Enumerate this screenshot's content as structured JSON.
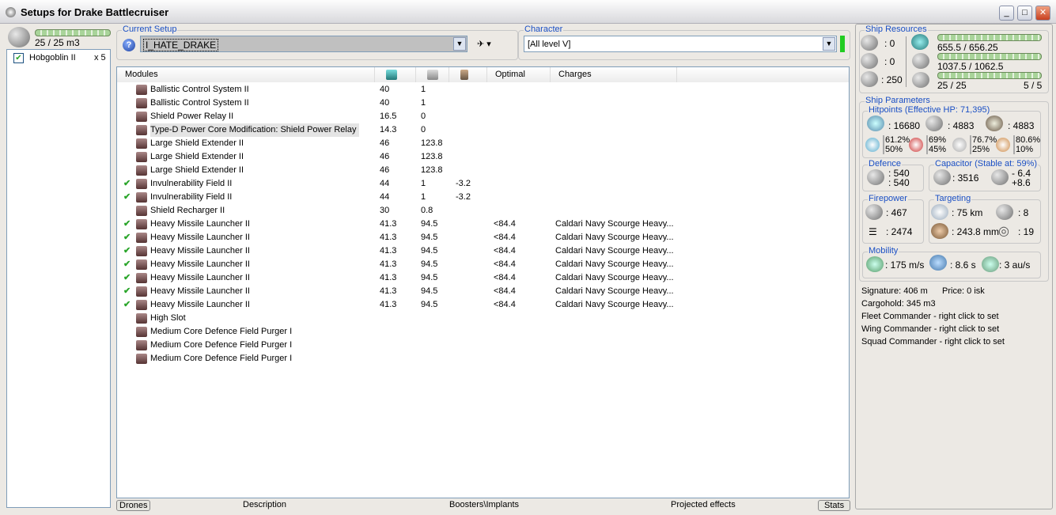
{
  "window": {
    "title": "Setups for Drake Battlecruiser"
  },
  "drones": {
    "bay": "25 / 25 m3",
    "items": [
      {
        "name": "Hobgoblin II",
        "count": "x 5",
        "checked": true
      }
    ]
  },
  "current_setup": {
    "label": "Current Setup",
    "value": "I_HATE_DRAKE"
  },
  "character": {
    "label": "Character",
    "value": "[All level V]",
    "status_color": "#22cc22"
  },
  "modules": {
    "headers": [
      "Modules",
      "cpu-icon",
      "powergrid-icon",
      "capacitor-icon",
      "Optimal",
      "Charges"
    ],
    "rows": [
      {
        "state": "",
        "name": "Ballistic Control System II",
        "cpu": "40",
        "pg": "1",
        "cap": "",
        "optimal": "",
        "charges": ""
      },
      {
        "state": "",
        "name": "Ballistic Control System II",
        "cpu": "40",
        "pg": "1",
        "cap": "",
        "optimal": "",
        "charges": ""
      },
      {
        "state": "",
        "name": "Shield Power Relay II",
        "cpu": "16.5",
        "pg": "0",
        "cap": "",
        "optimal": "",
        "charges": ""
      },
      {
        "state": "",
        "name": "Type-D Power Core Modification: Shield Power Relay",
        "cpu": "14.3",
        "pg": "0",
        "cap": "",
        "optimal": "",
        "charges": "",
        "selected": true
      },
      {
        "state": "",
        "name": "Large Shield Extender II",
        "cpu": "46",
        "pg": "123.8",
        "cap": "",
        "optimal": "",
        "charges": ""
      },
      {
        "state": "",
        "name": "Large Shield Extender II",
        "cpu": "46",
        "pg": "123.8",
        "cap": "",
        "optimal": "",
        "charges": ""
      },
      {
        "state": "",
        "name": "Large Shield Extender II",
        "cpu": "46",
        "pg": "123.8",
        "cap": "",
        "optimal": "",
        "charges": ""
      },
      {
        "state": "✔",
        "name": "Invulnerability Field II",
        "cpu": "44",
        "pg": "1",
        "cap": "-3.2",
        "optimal": "",
        "charges": ""
      },
      {
        "state": "✔",
        "name": "Invulnerability Field II",
        "cpu": "44",
        "pg": "1",
        "cap": "-3.2",
        "optimal": "",
        "charges": ""
      },
      {
        "state": "",
        "name": "Shield Recharger II",
        "cpu": "30",
        "pg": "0.8",
        "cap": "",
        "optimal": "",
        "charges": ""
      },
      {
        "state": "✔",
        "name": "Heavy Missile Launcher II",
        "cpu": "41.3",
        "pg": "94.5",
        "cap": "",
        "optimal": "<84.4",
        "charges": "Caldari Navy Scourge Heavy..."
      },
      {
        "state": "✔",
        "name": "Heavy Missile Launcher II",
        "cpu": "41.3",
        "pg": "94.5",
        "cap": "",
        "optimal": "<84.4",
        "charges": "Caldari Navy Scourge Heavy..."
      },
      {
        "state": "✔",
        "name": "Heavy Missile Launcher II",
        "cpu": "41.3",
        "pg": "94.5",
        "cap": "",
        "optimal": "<84.4",
        "charges": "Caldari Navy Scourge Heavy..."
      },
      {
        "state": "✔",
        "name": "Heavy Missile Launcher II",
        "cpu": "41.3",
        "pg": "94.5",
        "cap": "",
        "optimal": "<84.4",
        "charges": "Caldari Navy Scourge Heavy..."
      },
      {
        "state": "✔",
        "name": "Heavy Missile Launcher II",
        "cpu": "41.3",
        "pg": "94.5",
        "cap": "",
        "optimal": "<84.4",
        "charges": "Caldari Navy Scourge Heavy..."
      },
      {
        "state": "✔",
        "name": "Heavy Missile Launcher II",
        "cpu": "41.3",
        "pg": "94.5",
        "cap": "",
        "optimal": "<84.4",
        "charges": "Caldari Navy Scourge Heavy..."
      },
      {
        "state": "✔",
        "name": "Heavy Missile Launcher II",
        "cpu": "41.3",
        "pg": "94.5",
        "cap": "",
        "optimal": "<84.4",
        "charges": "Caldari Navy Scourge Heavy..."
      },
      {
        "state": "",
        "name": "High Slot",
        "cpu": "",
        "pg": "",
        "cap": "",
        "optimal": "",
        "charges": ""
      },
      {
        "state": "",
        "name": "Medium Core Defence Field Purger I",
        "cpu": "",
        "pg": "",
        "cap": "",
        "optimal": "",
        "charges": ""
      },
      {
        "state": "",
        "name": "Medium Core Defence Field Purger I",
        "cpu": "",
        "pg": "",
        "cap": "",
        "optimal": "",
        "charges": ""
      },
      {
        "state": "",
        "name": "Medium Core Defence Field Purger I",
        "cpu": "",
        "pg": "",
        "cap": "",
        "optimal": "",
        "charges": ""
      }
    ]
  },
  "bottom_tabs": [
    "Drones",
    "Description",
    "Boosters\\Implants",
    "Projected effects",
    "Stats"
  ],
  "resources": {
    "label": "Ship Resources",
    "turrets": ": 0",
    "launchers": ": 0",
    "calibration": ": 250",
    "cpu": "655.5 / 656.25",
    "cpu_fill": 0.999,
    "powergrid": "1037.5 / 1062.5",
    "powergrid_fill": 0.976,
    "drone_bandwidth": "25 / 25",
    "drones_active": "5 / 5",
    "bandwidth_fill": 1.0
  },
  "parameters": {
    "label": "Ship Parameters",
    "hitpoints": {
      "label": "Hitpoints (Effective HP: 71,395)",
      "shield": ": 16680",
      "armor": ": 4883",
      "structure": ": 4883",
      "resists": [
        {
          "a": "61.2%",
          "b": "50%"
        },
        {
          "a": "69%",
          "b": "45%"
        },
        {
          "a": "76.7%",
          "b": "25%"
        },
        {
          "a": "80.6%",
          "b": "10%"
        }
      ]
    },
    "defence": {
      "label": "Defence",
      "a": ": 540",
      "b": ": 540"
    },
    "capacitor": {
      "label": "Capacitor (Stable at: 59%)",
      "capacity": ": 3516",
      "use": "- 6.4",
      "recharge": "+8.6"
    },
    "firepower": {
      "label": "Firepower",
      "volley": ": 467",
      "dps": ": 2474"
    },
    "targeting": {
      "label": "Targeting",
      "range": ": 75 km",
      "targets": ": 8",
      "resolution": ": 243.8 mm",
      "sensor": ": 19"
    },
    "mobility": {
      "label": "Mobility",
      "speed": ": 175 m/s",
      "align": ": 8.6 s",
      "warp": ": 3 au/s"
    }
  },
  "info": {
    "signature": "Signature: 406 m",
    "price": "Price: 0 isk",
    "cargo": "Cargohold: 345 m3",
    "fleet": "Fleet Commander - right click to set",
    "wing": "Wing Commander - right click to set",
    "squad": "Squad Commander - right click to set"
  }
}
